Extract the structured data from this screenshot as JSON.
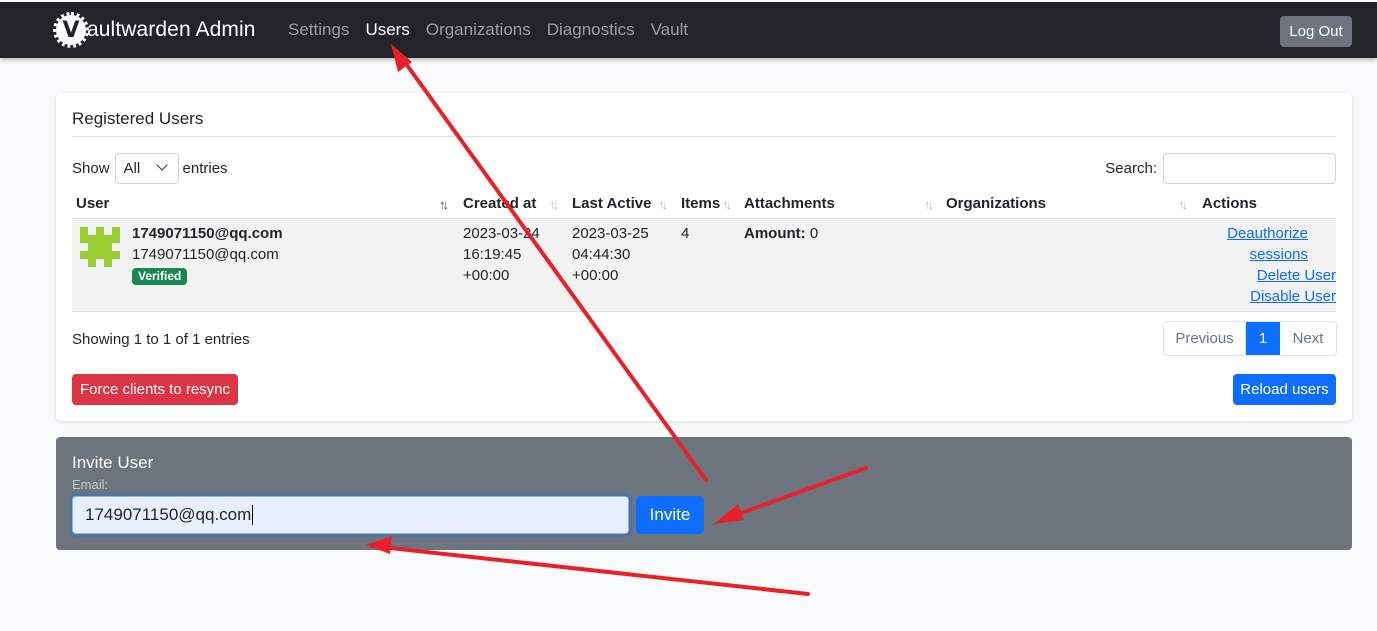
{
  "navbar": {
    "brand": "aultwarden Admin",
    "brand_logo_letter": "V",
    "links": [
      "Settings",
      "Users",
      "Organizations",
      "Diagnostics",
      "Vault"
    ],
    "active": "Users",
    "logout": "Log Out"
  },
  "users_card": {
    "title": "Registered Users",
    "show_label": "Show",
    "entries_value": "All",
    "entries_label": "entries",
    "search_label": "Search:",
    "search_value": "",
    "columns": [
      "User",
      "Created at",
      "Last Active",
      "Items",
      "Attachments",
      "Organizations",
      "Actions"
    ],
    "row": {
      "name": "1749071150@qq.com",
      "email": "1749071150@qq.com",
      "badge": "Verified",
      "created": [
        "2023-03-24",
        "16:19:45",
        "+00:00"
      ],
      "last_active": [
        "2023-03-25",
        "04:44:30",
        "+00:00"
      ],
      "items": "4",
      "attachments_label": "Amount:",
      "attachments_value": "0",
      "organizations": "",
      "actions": [
        "Deauthorize",
        "sessions",
        "Delete User",
        "Disable User"
      ]
    },
    "showing": "Showing 1 to 1 of 1 entries",
    "pagination": {
      "previous": "Previous",
      "current": "1",
      "next": "Next"
    },
    "force_resync": "Force clients to resync",
    "reload": "Reload users"
  },
  "invite": {
    "title": "Invite User",
    "email_label": "Email:",
    "email_value": "1749071150@qq.com",
    "button": "Invite"
  },
  "colors": {
    "navbar": "#212529",
    "primary": "#0d6efd",
    "danger": "#dc3545",
    "success": "#198754",
    "invite_bg": "#6c757d",
    "annotation_arrow": "#e8202a",
    "avatar": "#9acd32"
  },
  "icons": [
    "vaultwarden-logo-icon",
    "chevron-down-icon",
    "sort-icon",
    "identicon-avatar"
  ]
}
